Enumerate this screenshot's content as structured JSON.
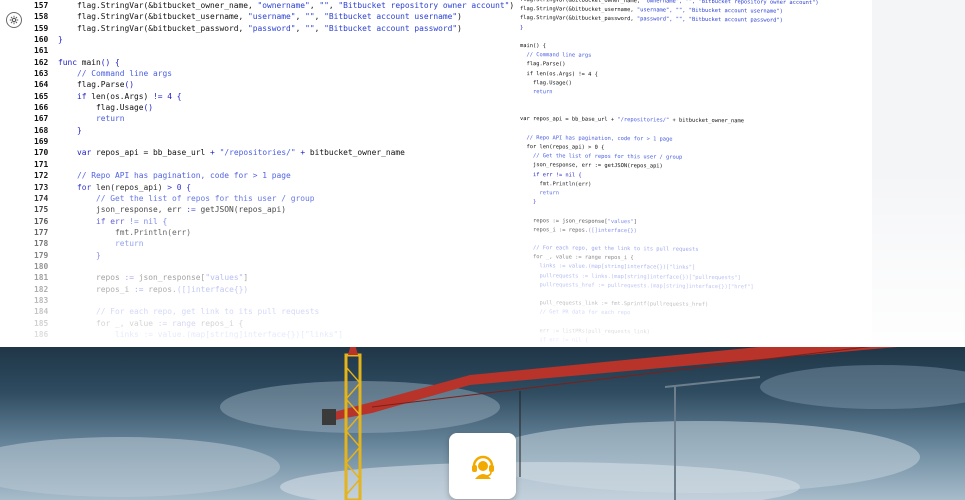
{
  "code_main": [
    {
      "n": "157",
      "t": [
        [
          "    ",
          ""
        ],
        [
          "flag.StringVar(&bitbucket_owner_name, ",
          "fn"
        ],
        [
          "\"ownername\"",
          "str"
        ],
        [
          ", ",
          "fn"
        ],
        [
          "\"\"",
          "str"
        ],
        [
          ", ",
          "fn"
        ],
        [
          "\"Bitbucket repository owner account\"",
          "str"
        ],
        [
          ")",
          "fn"
        ]
      ]
    },
    {
      "n": "158",
      "t": [
        [
          "    ",
          ""
        ],
        [
          "flag.StringVar(&bitbucket_username, ",
          "fn"
        ],
        [
          "\"username\"",
          "str"
        ],
        [
          ", ",
          "fn"
        ],
        [
          "\"\"",
          "str"
        ],
        [
          ", ",
          "fn"
        ],
        [
          "\"Bitbucket account username\"",
          "str"
        ],
        [
          ")",
          "fn"
        ]
      ]
    },
    {
      "n": "159",
      "t": [
        [
          "    ",
          ""
        ],
        [
          "flag.StringVar(&bitbucket_password, ",
          "fn"
        ],
        [
          "\"password\"",
          "str"
        ],
        [
          ", ",
          "fn"
        ],
        [
          "\"\"",
          "str"
        ],
        [
          ", ",
          "fn"
        ],
        [
          "\"Bitbucket account password\"",
          "str"
        ],
        [
          ")",
          "fn"
        ]
      ]
    },
    {
      "n": "160",
      "t": [
        [
          "}",
          "kw"
        ]
      ]
    },
    {
      "n": "161",
      "t": []
    },
    {
      "n": "162",
      "t": [
        [
          "func ",
          "kw"
        ],
        [
          "main",
          "fn"
        ],
        [
          "() {",
          "kw"
        ]
      ]
    },
    {
      "n": "163",
      "t": [
        [
          "    ",
          ""
        ],
        [
          "// Command line args",
          "cm"
        ]
      ]
    },
    {
      "n": "164",
      "t": [
        [
          "    ",
          ""
        ],
        [
          "flag.Parse",
          "fn"
        ],
        [
          "()",
          "kw"
        ]
      ]
    },
    {
      "n": "165",
      "t": [
        [
          "    ",
          ""
        ],
        [
          "if ",
          "kw"
        ],
        [
          "len(os.Args) ",
          "fn"
        ],
        [
          "!= 4 {",
          "kw"
        ]
      ]
    },
    {
      "n": "166",
      "t": [
        [
          "        ",
          ""
        ],
        [
          "flag.Usage",
          "fn"
        ],
        [
          "()",
          "kw"
        ]
      ]
    },
    {
      "n": "167",
      "t": [
        [
          "        ",
          ""
        ],
        [
          "return",
          "cm"
        ]
      ]
    },
    {
      "n": "168",
      "t": [
        [
          "    ",
          ""
        ],
        [
          "}",
          "kw"
        ]
      ]
    },
    {
      "n": "169",
      "t": []
    },
    {
      "n": "170",
      "t": [
        [
          "    ",
          ""
        ],
        [
          "var ",
          "kw"
        ],
        [
          "repos_api = bb_base_url ",
          "fn"
        ],
        [
          "+ ",
          "kw"
        ],
        [
          "\"/repositories/\"",
          "cm"
        ],
        [
          " + ",
          "kw"
        ],
        [
          "bitbucket_owner_name",
          "fn"
        ]
      ]
    },
    {
      "n": "171",
      "t": []
    },
    {
      "n": "172",
      "t": [
        [
          "    ",
          ""
        ],
        [
          "// Repo API has pagination, code for > 1 page",
          "cm"
        ]
      ]
    },
    {
      "n": "173",
      "t": [
        [
          "    ",
          ""
        ],
        [
          "for ",
          "kw"
        ],
        [
          "len(repos_api) ",
          "fn"
        ],
        [
          "> 0 {",
          "kw"
        ]
      ]
    },
    {
      "n": "174",
      "t": [
        [
          "        ",
          ""
        ],
        [
          "// Get the list of repos for this user / group",
          "cm"
        ]
      ]
    },
    {
      "n": "175",
      "t": [
        [
          "        ",
          ""
        ],
        [
          "json_response, err ",
          "fn"
        ],
        [
          ":= ",
          "kw"
        ],
        [
          "getJSON(repos_api)",
          "fn"
        ]
      ]
    },
    {
      "n": "176",
      "t": [
        [
          "        ",
          ""
        ],
        [
          "if err ",
          "kw"
        ],
        [
          "!= nil {",
          "cm"
        ]
      ]
    },
    {
      "n": "177",
      "t": [
        [
          "            ",
          ""
        ],
        [
          "fmt.Println(err)",
          "fn"
        ]
      ]
    },
    {
      "n": "178",
      "t": [
        [
          "            ",
          ""
        ],
        [
          "return",
          "cm"
        ]
      ]
    },
    {
      "n": "179",
      "t": [
        [
          "        ",
          ""
        ],
        [
          "}",
          "kw"
        ]
      ]
    },
    {
      "n": "180",
      "t": []
    },
    {
      "n": "181",
      "t": [
        [
          "        ",
          ""
        ],
        [
          "repos ",
          "fn"
        ],
        [
          ":= ",
          "kw"
        ],
        [
          "json_response[",
          "fn"
        ],
        [
          "\"values\"",
          "cm"
        ],
        [
          "]",
          "fn"
        ]
      ]
    },
    {
      "n": "182",
      "t": [
        [
          "        ",
          ""
        ],
        [
          "repos_i ",
          "fn"
        ],
        [
          ":= ",
          "kw"
        ],
        [
          "repos.",
          "fn"
        ],
        [
          "([]interface{})",
          "cm"
        ]
      ]
    },
    {
      "n": "183",
      "t": []
    },
    {
      "n": "184",
      "t": [
        [
          "        ",
          ""
        ],
        [
          "// For each repo, get link to its pull requests",
          "cm"
        ]
      ]
    },
    {
      "n": "185",
      "t": [
        [
          "        ",
          ""
        ],
        [
          "for _, value ",
          "fn"
        ],
        [
          ":= range ",
          "kw"
        ],
        [
          "repos_i {",
          "fn"
        ]
      ]
    },
    {
      "n": "186",
      "t": [
        [
          "            ",
          ""
        ],
        [
          "links := value.(map[string]interface{})[\"links\"]",
          "cm"
        ]
      ]
    }
  ],
  "code_side": [
    [
      [
        "flag.StringVar(&bitbucket_owner_name, ",
        "fn"
      ],
      [
        "\"ownername\", \"\", \"Bitbucket repository owner account\")",
        "str"
      ]
    ],
    [
      [
        "flag.StringVar(&bitbucket_username, ",
        "fn"
      ],
      [
        "\"username\", \"\", \"Bitbucket account username\")",
        "str"
      ]
    ],
    [
      [
        "flag.StringVar(&bitbucket_password, ",
        "fn"
      ],
      [
        "\"password\", \"\", \"Bitbucket account password\")",
        "str"
      ]
    ],
    [
      [
        "}",
        "kw"
      ]
    ],
    [
      [
        "",
        ""
      ]
    ],
    [
      [
        "main() {",
        "fn"
      ]
    ],
    [
      [
        "  // Command line args",
        "cm"
      ]
    ],
    [
      [
        "  flag.Parse()",
        "fn"
      ]
    ],
    [
      [
        "  if len(os.Args) != 4 {",
        "fn"
      ]
    ],
    [
      [
        "    flag.Usage()",
        "fn"
      ]
    ],
    [
      [
        "    return",
        "cm"
      ]
    ],
    [
      [
        "",
        ""
      ]
    ],
    [
      [
        "",
        ""
      ]
    ],
    [
      [
        "var repos_api = bb_base_url + ",
        "fn"
      ],
      [
        "\"/repositories/\"",
        "cm"
      ],
      [
        " + bitbucket_owner_name",
        "fn"
      ]
    ],
    [
      [
        "",
        ""
      ]
    ],
    [
      [
        "  // Repo API has pagination, code for > 1 page",
        "cm"
      ]
    ],
    [
      [
        "  for len(repos_api) > 0 {",
        "fn"
      ]
    ],
    [
      [
        "    // Get the list of repos for this user / group",
        "cm"
      ]
    ],
    [
      [
        "    json_response, err := getJSON(repos_api)",
        "fn"
      ]
    ],
    [
      [
        "    if err != nil {",
        "kw"
      ]
    ],
    [
      [
        "      fmt.Println(err)",
        "fn"
      ]
    ],
    [
      [
        "      return",
        "cm"
      ]
    ],
    [
      [
        "    }",
        "kw"
      ]
    ],
    [
      [
        "",
        ""
      ]
    ],
    [
      [
        "    repos := json_response[",
        "fn"
      ],
      [
        "\"values\"",
        "cm"
      ],
      [
        "]",
        "fn"
      ]
    ],
    [
      [
        "    repos_i := repos.",
        "fn"
      ],
      [
        "([]interface{})",
        "cm"
      ]
    ],
    [
      [
        "",
        ""
      ]
    ],
    [
      [
        "    // For each repo, get the link to its pull requests",
        "cm"
      ]
    ],
    [
      [
        "    for _, value := range repos_i {",
        "fn"
      ]
    ],
    [
      [
        "      links := value.(map[string]interface{})[\"links\"]",
        "cm"
      ]
    ],
    [
      [
        "      pullrequests := links.(map[string]interface{})[\"pullrequests\"]",
        "cm"
      ]
    ],
    [
      [
        "      pullrequests_href := pullrequests.(map[string]interface{})[\"href\"]",
        "cm"
      ]
    ],
    [
      [
        "",
        ""
      ]
    ],
    [
      [
        "      pull_requests_link := fmt.Sprintf(pullrequests_href)",
        "fn"
      ]
    ],
    [
      [
        "      // Get PR data for each repo",
        "cm"
      ]
    ],
    [
      [
        "",
        ""
      ]
    ],
    [
      [
        "      err := listPRs(pull_requests_link)",
        "fn"
      ]
    ],
    [
      [
        "      if err != nil {",
        "kw"
      ]
    ]
  ],
  "colors": {
    "keyword": "#2020c8",
    "string": "#2a3fd2",
    "comment": "#4a5ee0",
    "hero_sky_top": "#1f3647",
    "crane_red": "#b8332a",
    "crane_yellow": "#e5b31a",
    "badge_icon": "#f2a900"
  },
  "icons": {
    "gutter": "settings-wheel-icon",
    "badge": "support-agent-icon"
  }
}
